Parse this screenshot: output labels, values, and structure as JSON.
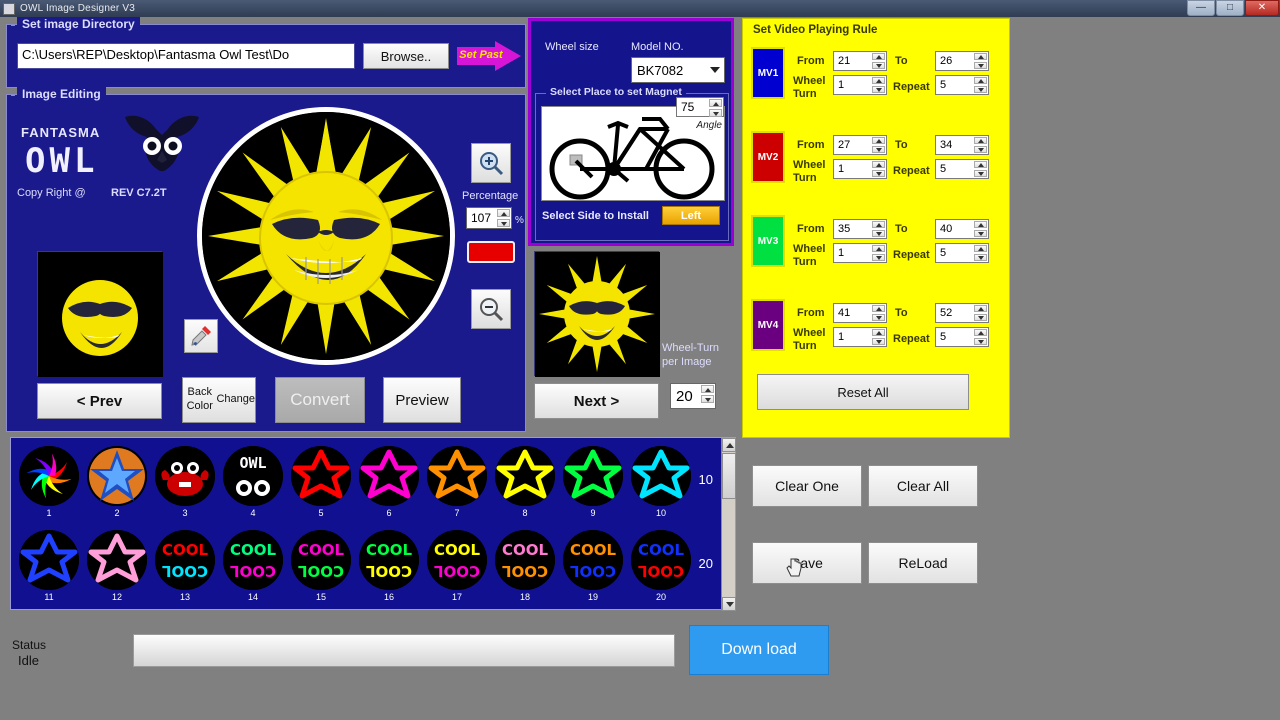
{
  "window": {
    "title": "OWL Image Designer V3",
    "minimize_label": "—",
    "maximize_label": "□",
    "close_label": "✕"
  },
  "directory_group": {
    "title": "Set image Directory",
    "path_value": "C:\\Users\\REP\\Desktop\\Fantasma Owl Test\\Do",
    "path_placeholder": "Select image folder",
    "browse_label": "Browse..",
    "set_past_label": "Set Past"
  },
  "image_editing": {
    "title": "Image Editing",
    "brand_top": "FANTASMA",
    "brand_main": "OWL",
    "copyright": "Copy Right @",
    "revision": "REV C7.2T",
    "percentage_label": "Percentage",
    "percentage_value": "107",
    "percent_sign": "%",
    "zoom_in_icon": "zoom-in-icon",
    "zoom_out_icon": "zoom-out-icon",
    "color_swatch_hex": "#e60000",
    "prev_label": "< Prev",
    "back_color_label": "Back Color\nChange",
    "back_color_line1": "Back Color",
    "back_color_line2": "Change",
    "convert_label": "Convert",
    "preview_label": "Preview",
    "next_label": "Next >",
    "wheel_turn_label_line1": "Wheel-Turn",
    "wheel_turn_label_line2": "per Image",
    "wheel_turn_value": "20"
  },
  "wheel_panel": {
    "wheel_size_label": "Wheel size",
    "model_no_label": "Model NO.",
    "model_value": "BK7082",
    "model_options": [
      "BK7082"
    ],
    "magnet_title": "Select Place to set Magnet",
    "angle_value": "75",
    "angle_label": "Angle",
    "select_side_label": "Select Side to Install",
    "side_value": "Left",
    "accent_hex": "#9d00d6"
  },
  "video_rules": {
    "title": "Set Video Playing Rule",
    "from_label": "From",
    "to_label": "To",
    "wheel_turn_label_line1": "Wheel",
    "wheel_turn_label_line2": "Turn",
    "repeat_label": "Repeat",
    "reset_all_label": "Reset All",
    "panel_hex": "#ffff00",
    "rows": [
      {
        "name": "MV1",
        "color": "#0000d0",
        "from": "21",
        "to": "26",
        "wheel_turn": "1",
        "repeat": "5"
      },
      {
        "name": "MV2",
        "color": "#cc0000",
        "from": "27",
        "to": "34",
        "wheel_turn": "1",
        "repeat": "5"
      },
      {
        "name": "MV3",
        "color": "#00e040",
        "from": "35",
        "to": "40",
        "wheel_turn": "1",
        "repeat": "5"
      },
      {
        "name": "MV4",
        "color": "#6a0080",
        "from": "41",
        "to": "52",
        "wheel_turn": "1",
        "repeat": "5"
      }
    ]
  },
  "gallery": {
    "row1_count": "10",
    "row2_count": "20",
    "items": [
      {
        "num": "1",
        "kind": "spiral",
        "color": "#ff4d00"
      },
      {
        "num": "2",
        "kind": "starball",
        "color": "#2f6bd8"
      },
      {
        "num": "3",
        "kind": "crab",
        "color": "#cc0000"
      },
      {
        "num": "4",
        "kind": "owl",
        "color": "#ffffff"
      },
      {
        "num": "5",
        "kind": "star6",
        "color": "#ff0000"
      },
      {
        "num": "6",
        "kind": "star6",
        "color": "#ff00d0"
      },
      {
        "num": "7",
        "kind": "star6",
        "color": "#ff9000"
      },
      {
        "num": "8",
        "kind": "star6",
        "color": "#ffff00"
      },
      {
        "num": "9",
        "kind": "star6",
        "color": "#00ff40"
      },
      {
        "num": "10",
        "kind": "star6",
        "color": "#00e5ff"
      },
      {
        "num": "11",
        "kind": "star6",
        "color": "#2040ff"
      },
      {
        "num": "12",
        "kind": "star6",
        "color": "#ff9ed8"
      },
      {
        "num": "13",
        "kind": "cool",
        "color": "#ff0000",
        "color2": "#00e5ff",
        "text": "COOL"
      },
      {
        "num": "14",
        "kind": "cool",
        "color": "#00ff80",
        "color2": "#ff00d0",
        "text": "COOL"
      },
      {
        "num": "15",
        "kind": "cool",
        "color": "#ff00d0",
        "color2": "#00ff40",
        "text": "COOL"
      },
      {
        "num": "16",
        "kind": "cool",
        "color": "#00ff40",
        "color2": "#ffff00",
        "text": "COOL"
      },
      {
        "num": "17",
        "kind": "cool",
        "color": "#ffff00",
        "color2": "#ff00d0",
        "text": "COOL"
      },
      {
        "num": "18",
        "kind": "cool",
        "color": "#ff7ad0",
        "color2": "#ff9000",
        "text": "COOL"
      },
      {
        "num": "19",
        "kind": "cool",
        "color": "#ff9000",
        "color2": "#1030ff",
        "text": "COOL"
      },
      {
        "num": "20",
        "kind": "cool",
        "color": "#1030ff",
        "color2": "#ff0000",
        "text": "COOL"
      }
    ]
  },
  "actions": {
    "clear_one_label": "Clear One",
    "clear_all_label": "Clear All",
    "save_label": "Save",
    "reload_label": "ReLoad"
  },
  "status_bar": {
    "status_label": "Status",
    "status_value": "Idle",
    "progress_percent": "0",
    "download_label": "Down load",
    "download_hex": "#2e9bf0"
  }
}
